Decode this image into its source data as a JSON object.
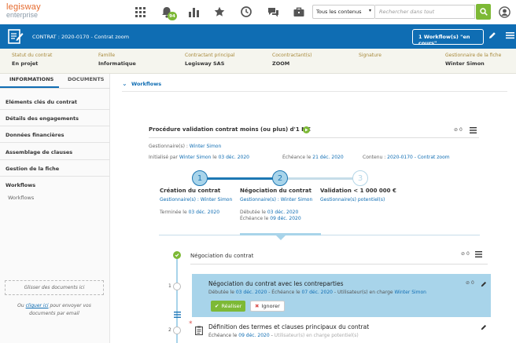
{
  "app": {
    "logo_top": "legisway",
    "logo_bottom": "enterprise",
    "notif_count": "94"
  },
  "search": {
    "scope": "Tous les contenus",
    "placeholder": "Rechercher dans tout"
  },
  "header": {
    "contract_title": "CONTRAT : 2020-0170 - Contrat zoom",
    "workflow_button": "1 Workflow(s) \"en cours\""
  },
  "info": [
    {
      "label": "Statut du contrat",
      "value": "En projet"
    },
    {
      "label": "Famille",
      "value": "Informatique"
    },
    {
      "label": "Contractant principal",
      "value": "Legisway SAS"
    },
    {
      "label": "Cocontractant(s)",
      "value": "ZOOM"
    },
    {
      "label": "Signature",
      "value": ""
    },
    {
      "label": "Gestionnaire de la fiche",
      "value": "Winter Simon"
    }
  ],
  "sidebar": {
    "tabs": [
      "INFORMATIONS",
      "DOCUMENTS"
    ],
    "items": [
      "Eléments clés du contrat",
      "Détails des engagements",
      "Données financières",
      "Assemblage de clauses",
      "Gestion de la fiche"
    ],
    "workflows_title": "Workflows",
    "workflows_sub": "Workflows",
    "drop_label": "Glisser des documents ici",
    "drop_text_1": "Ou",
    "drop_link": "cliquer ici",
    "drop_text_2": "pour envoyer vos",
    "drop_text_3": "documents par email"
  },
  "main": {
    "section_title": "Workflows",
    "procedure_title": "Procédure validation contrat moins (ou plus) d'1 M€",
    "attach_count": "0",
    "managers_label": "Gestionnaire(s) :",
    "managers_value": "Winter Simon",
    "initiated_label": "Initialisé par",
    "initiated_by": "Winter Simon",
    "initiated_on_label": "le",
    "initiated_date": "03 déc. 2020",
    "due_label": "Échéance le",
    "due_date": "21 déc. 2020",
    "content_label": "Contenu :",
    "content_value": "2020-0170 - Contrat zoom",
    "steps": [
      {
        "num": "1",
        "title": "Création du contrat",
        "managers_label": "Gestionnaire(s) :",
        "managers": "Winter Simon",
        "line1_label": "Terminée le",
        "line1_date": "03 déc. 2020",
        "line2_label": "",
        "line2_date": ""
      },
      {
        "num": "2",
        "title": "Négociation du contrat",
        "managers_label": "Gestionnaire(s) :",
        "managers": "Winter Simon",
        "line1_label": "Débutée le",
        "line1_date": "03 déc. 2020",
        "line2_label": "Échéance le",
        "line2_date": "09 déc. 2020"
      },
      {
        "num": "3",
        "title": "Validation < 1 000 000 €",
        "managers_label": "Gestionnaire(s) potentiel(s)",
        "managers": "",
        "line1_label": "",
        "line1_date": "",
        "line2_label": "",
        "line2_date": ""
      }
    ],
    "stage_title": "Négociation du contrat",
    "stage_attach": "0",
    "tasks": [
      {
        "num": "1",
        "title": "Négociation du contrat avec les contreparties",
        "started_label": "Débutée le",
        "started": "03 déc. 2020",
        "due_label": "Échéance le",
        "due": "07 déc. 2020",
        "users_label": "Utilisateur(s) en charge",
        "users": "Winter Simon",
        "attach": "0",
        "done_label": "Réaliser",
        "ignore_label": "Ignorer"
      },
      {
        "num": "2",
        "title": "Définition des termes et clauses principaux du contrat",
        "due_label": "Échéance le",
        "due": "09 déc. 2020",
        "users_label": "Utilisateur(s) en charge potentiel(s)"
      }
    ]
  }
}
